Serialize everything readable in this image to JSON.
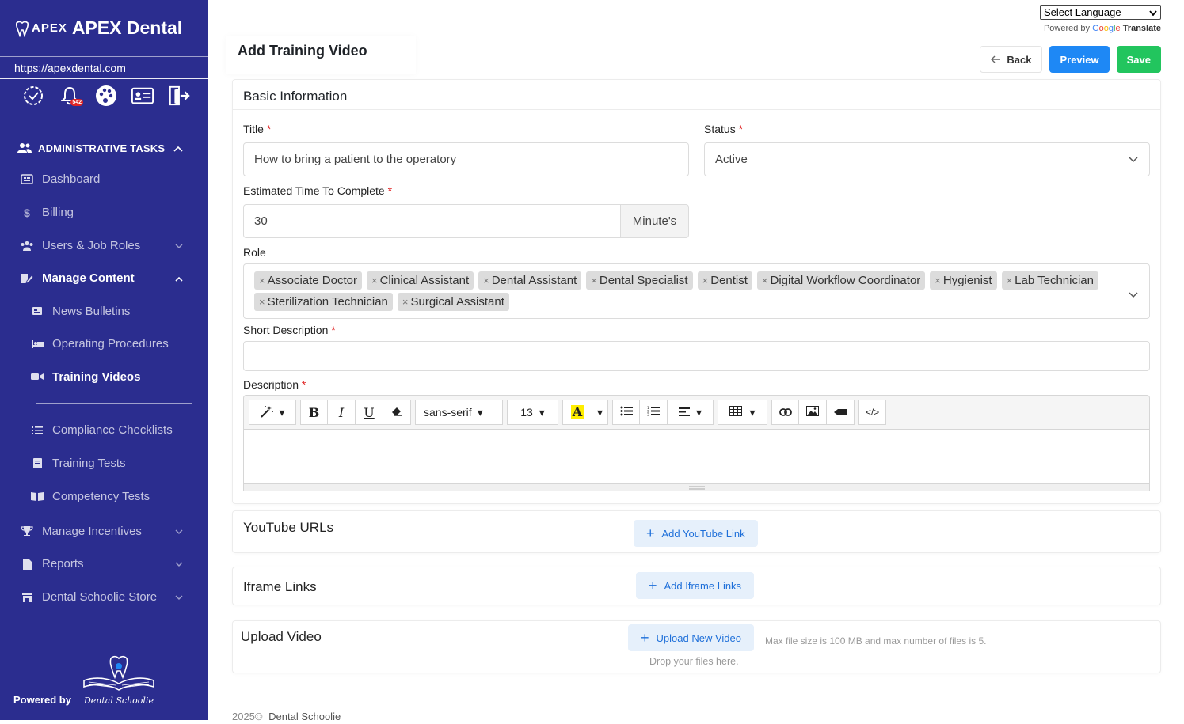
{
  "sidebar": {
    "logo_text": "APEX",
    "brand_name": "APEX Dental",
    "site_url": "https://apexdental.com",
    "notification_count": "542",
    "section_title": "ADMINISTRATIVE TASKS",
    "items": [
      {
        "label": "Dashboard",
        "icon": "dashboard-icon"
      },
      {
        "label": "Billing",
        "icon": "dollar-icon"
      },
      {
        "label": "Users & Job Roles",
        "icon": "users-icon"
      },
      {
        "label": "Manage Content",
        "icon": "edit-icon"
      },
      {
        "label": "News Bulletins",
        "icon": "newspaper-icon"
      },
      {
        "label": "Operating Procedures",
        "icon": "bed-icon"
      },
      {
        "label": "Training Videos",
        "icon": "video-icon"
      },
      {
        "label": "Compliance Checklists",
        "icon": "checklist-icon"
      },
      {
        "label": "Training Tests",
        "icon": "test-icon"
      },
      {
        "label": "Competency Tests",
        "icon": "book-icon"
      },
      {
        "label": "Manage Incentives",
        "icon": "trophy-icon"
      },
      {
        "label": "Reports",
        "icon": "file-icon"
      },
      {
        "label": "Dental Schoolie Store",
        "icon": "store-icon"
      }
    ],
    "powered_by": "Powered by",
    "partner_logo_text": "Dental Schoolie"
  },
  "translate": {
    "select_label": "Select Language",
    "powered_by": "Powered by",
    "google": [
      "G",
      "o",
      "o",
      "g",
      "l",
      "e"
    ],
    "translate": "Translate"
  },
  "page": {
    "title": "Add Training Video",
    "back_label": "Back",
    "preview_label": "Preview",
    "save_label": "Save"
  },
  "basic": {
    "header": "Basic Information",
    "title_label": "Title",
    "title_value": "How to bring a patient to the operatory",
    "status_label": "Status",
    "status_value": "Active",
    "time_label": "Estimated Time To Complete",
    "time_value": "30",
    "time_unit": "Minute's",
    "role_label": "Role",
    "roles": [
      "Associate Doctor",
      "Clinical Assistant",
      "Dental Assistant",
      "Dental Specialist",
      "Dentist",
      "Digital Workflow Coordinator",
      "Hygienist",
      "Lab Technician",
      "Sterilization Technician",
      "Surgical Assistant"
    ],
    "short_desc_label": "Short Description",
    "short_desc_value": "",
    "desc_label": "Description",
    "font_family": "sans-serif",
    "font_size": "13"
  },
  "youtube": {
    "title": "YouTube URLs",
    "button": "Add YouTube Link"
  },
  "iframe": {
    "title": "Iframe Links",
    "button": "Add Iframe Links"
  },
  "upload": {
    "title": "Upload Video",
    "button": "Upload New Video",
    "limit_note": "Max file size is 100 MB and max number of files is 5.",
    "drop_note": "Drop your files here."
  },
  "footer": {
    "year": "2025©",
    "company": "Dental Schoolie"
  },
  "colors": {
    "sidebar": "#2b2d8f",
    "primary": "#1e88f5",
    "success": "#22c55e",
    "required": "#e02424"
  }
}
